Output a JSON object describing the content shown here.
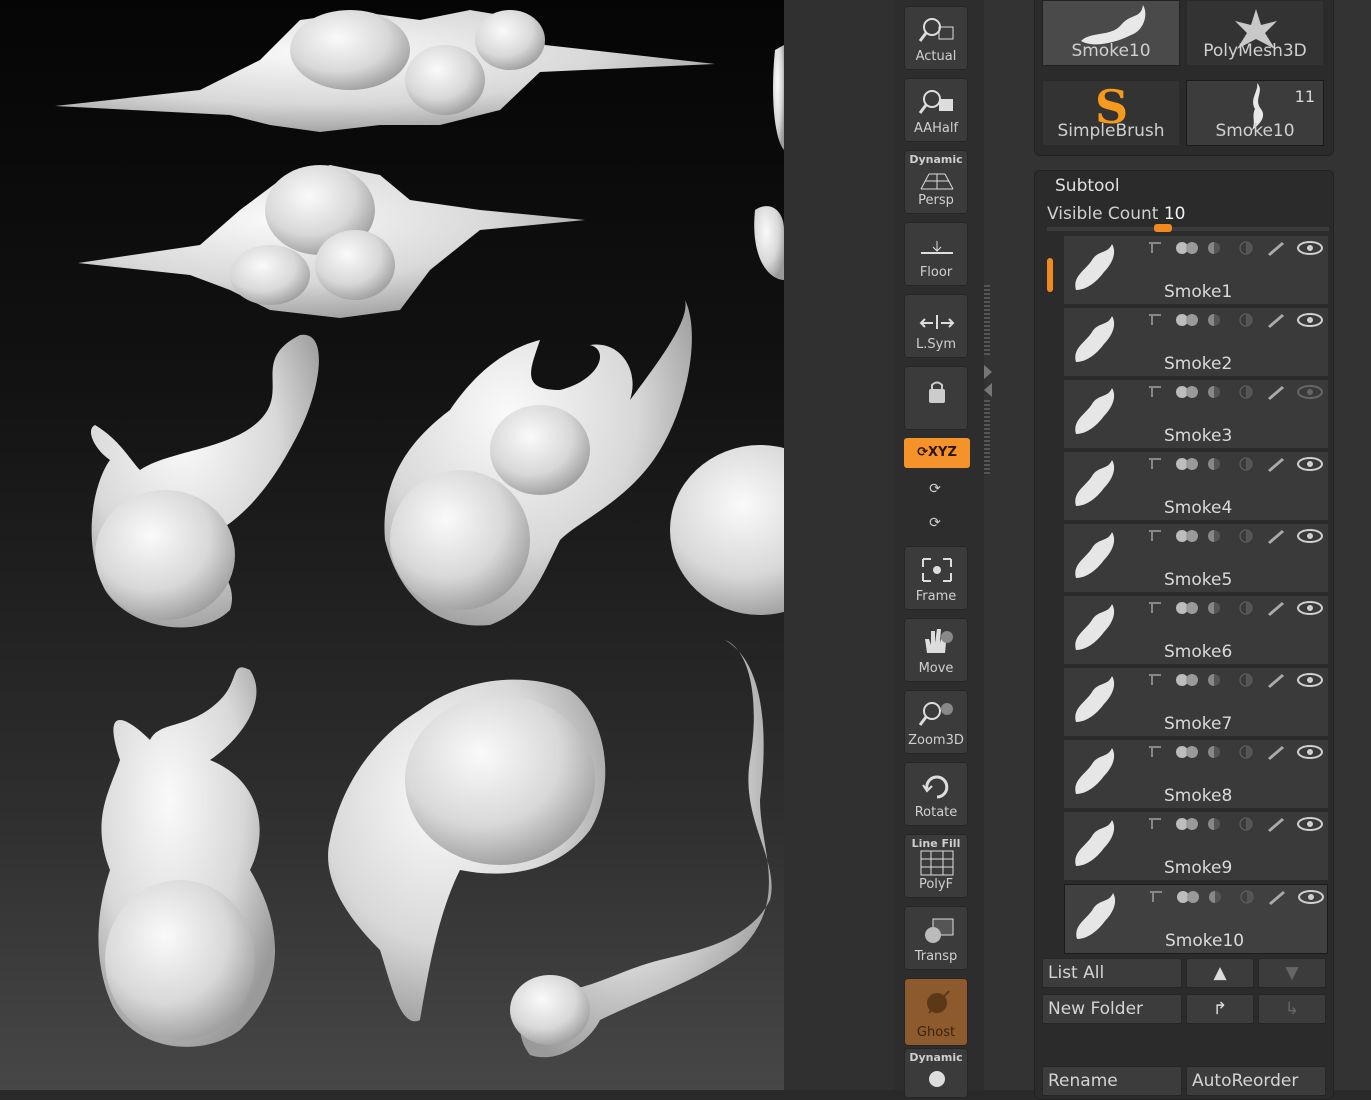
{
  "shelf": {
    "actual": "Actual",
    "aahalf": "AAHalf",
    "persp_super": "Dynamic",
    "persp": "Persp",
    "floor": "Floor",
    "lsym": "L.Sym",
    "xyz": "XYZ",
    "frame": "Frame",
    "move": "Move",
    "zoom3d": "Zoom3D",
    "rotate": "Rotate",
    "polyf_super": "Line Fill",
    "polyf": "PolyF",
    "transp": "Transp",
    "ghost": "Ghost",
    "dynamic_bottom": "Dynamic"
  },
  "tools": {
    "items": [
      {
        "label": "Smoke10"
      },
      {
        "label": "PolyMesh3D"
      },
      {
        "label": "SimpleBrush"
      },
      {
        "label": "Smoke10",
        "count": "11"
      }
    ]
  },
  "subtool": {
    "title": "Subtool",
    "visible_count_label": "Visible Count",
    "visible_count_value": "10",
    "visible_count_fraction": 0.38,
    "items": [
      {
        "name": "Smoke1"
      },
      {
        "name": "Smoke2"
      },
      {
        "name": "Smoke3"
      },
      {
        "name": "Smoke4"
      },
      {
        "name": "Smoke5"
      },
      {
        "name": "Smoke6"
      },
      {
        "name": "Smoke7"
      },
      {
        "name": "Smoke8"
      },
      {
        "name": "Smoke9"
      },
      {
        "name": "Smoke10",
        "selected": true
      }
    ],
    "buttons": {
      "list_all": "List All",
      "new_folder": "New Folder",
      "rename": "Rename",
      "auto_reorder": "AutoReorder"
    }
  },
  "colors": {
    "accent": "#f5932a",
    "panel": "#333333",
    "viewport_top": "#050505"
  }
}
